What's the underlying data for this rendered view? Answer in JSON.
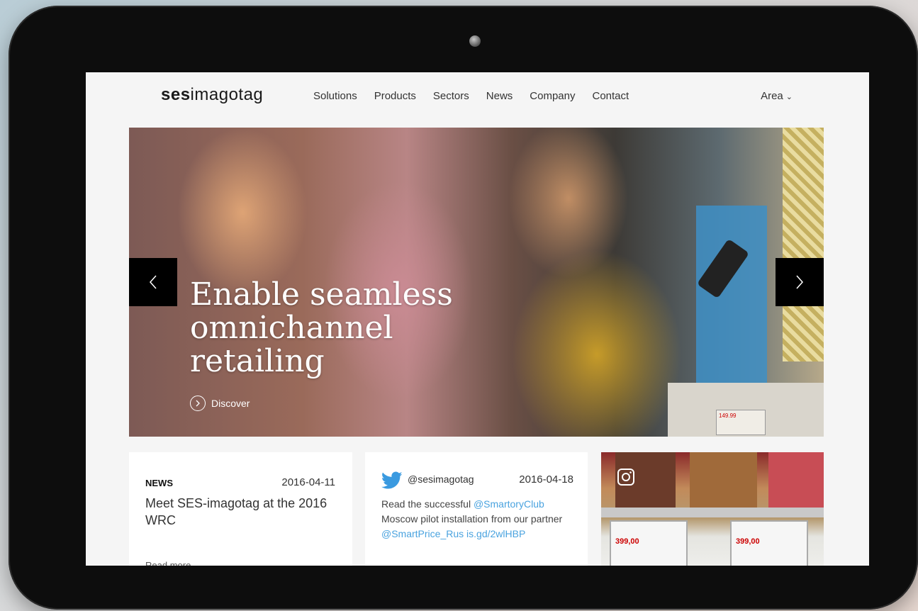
{
  "header": {
    "logo_bold": "ses",
    "logo_light": "imagotag",
    "nav": [
      "Solutions",
      "Products",
      "Sectors",
      "News",
      "Company",
      "Contact"
    ],
    "area_label": "Area"
  },
  "hero": {
    "title_line1": "Enable seamless",
    "title_line2": "omnichannel",
    "title_line3": "retailing",
    "discover_label": "Discover"
  },
  "news_card": {
    "label": "NEWS",
    "date": "2016-04-11",
    "headline": "Meet SES-imagotag at the 2016 WRC",
    "more_label": "Read more"
  },
  "tweet_card": {
    "handle": "@sesimagotag",
    "date": "2016-04-18",
    "text_part1": "Read the successful ",
    "mention1": "@SmartoryClub",
    "text_part2": " Moscow pilot installation from our partner ",
    "mention2": "@SmartPrice_Rus",
    "link": " is.gd/2wlHBP"
  },
  "photo_card": {
    "price_left": "399,00",
    "price_right": "399,00",
    "hero_price": "149.99"
  },
  "colors": {
    "accent_link": "#4aa3df",
    "tablet_frame": "#0d0d0d",
    "arrow_bg": "#000000"
  }
}
